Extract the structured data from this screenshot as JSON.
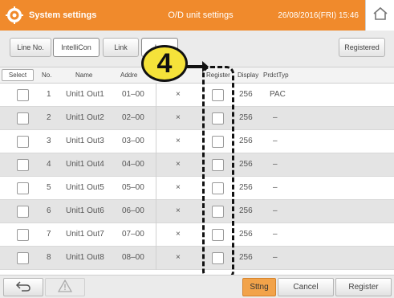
{
  "header": {
    "title": "System settings",
    "subtitle": "O/D unit settings",
    "datetime": "26/08/2016(FRI) 15:46",
    "icons": {
      "settings": "gear-icon",
      "home": "home-icon"
    }
  },
  "toolbar": {
    "line_no_label": "Line No.",
    "line_value": "IntelliCon",
    "link_label": "Link",
    "link_value": "L...",
    "registered_label": "Registered"
  },
  "columns": {
    "select": "Select",
    "no": "No.",
    "name": "Name",
    "address": "Addre",
    "register": "Register",
    "display": "Display",
    "prdct_typ": "PrdctTyp"
  },
  "rows": [
    {
      "no": "1",
      "name": "Unit1 Out1",
      "address": "01–00",
      "mark": "×",
      "display": "256",
      "type": "PAC"
    },
    {
      "no": "2",
      "name": "Unit1 Out2",
      "address": "02–00",
      "mark": "×",
      "display": "256",
      "type": "–"
    },
    {
      "no": "3",
      "name": "Unit1 Out3",
      "address": "03–00",
      "mark": "×",
      "display": "256",
      "type": "–"
    },
    {
      "no": "4",
      "name": "Unit1 Out4",
      "address": "04–00",
      "mark": "×",
      "display": "256",
      "type": "–"
    },
    {
      "no": "5",
      "name": "Unit1 Out5",
      "address": "05–00",
      "mark": "×",
      "display": "256",
      "type": "–"
    },
    {
      "no": "6",
      "name": "Unit1 Out6",
      "address": "06–00",
      "mark": "×",
      "display": "256",
      "type": "–"
    },
    {
      "no": "7",
      "name": "Unit1 Out7",
      "address": "07–00",
      "mark": "×",
      "display": "256",
      "type": "–"
    },
    {
      "no": "8",
      "name": "Unit1 Out8",
      "address": "08–00",
      "mark": "×",
      "display": "256",
      "type": "–"
    }
  ],
  "callout": {
    "number": "4"
  },
  "footer": {
    "back_icon": "back-arrow-icon",
    "warning_icon": "warning-icon",
    "settings_label": "Sttng",
    "cancel_label": "Cancel",
    "register_label": "Register"
  },
  "colors": {
    "header": "#f08a2c",
    "accent_button": "#f2a34a",
    "callout": "#f5e23a"
  }
}
